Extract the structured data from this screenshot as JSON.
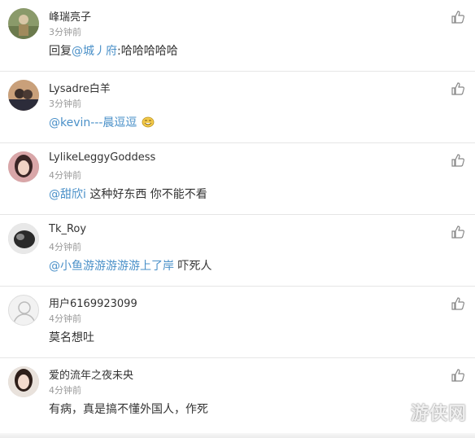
{
  "comments": [
    {
      "username": "峰瑞亮子",
      "time": "3分钟前",
      "prefix": "回复",
      "mention": "@城丿府",
      "text": ":哈哈哈哈哈",
      "avatar": "avatar-photo-outdoor"
    },
    {
      "username": "Lysadre白羊",
      "time": "3分钟前",
      "prefix": "",
      "mention": "@kevin---晨逗逗",
      "text": "",
      "emoji": "grin-emoji",
      "avatar": "avatar-photo-couple"
    },
    {
      "username": "LylikeLeggyGoddess",
      "time": "4分钟前",
      "prefix": "",
      "mention": "@甜欣i",
      "text": " 这种好东西 你不能不看",
      "avatar": "avatar-photo-girl"
    },
    {
      "username": "Tk_Roy",
      "time": "4分钟前",
      "prefix": "",
      "mention": "@小鱼游游游游游上了岸",
      "text": " 吓死人",
      "avatar": "avatar-photo-bw"
    },
    {
      "username": "用户6169923099",
      "time": "4分钟前",
      "prefix": "",
      "mention": "",
      "text": "莫名想吐",
      "avatar": "avatar-default"
    },
    {
      "username": "爱的流年之夜未央",
      "time": "4分钟前",
      "prefix": "",
      "mention": "",
      "text": "有病，真是搞不懂外国人，作死",
      "avatar": "avatar-photo-woman"
    }
  ],
  "watermark": "游侠网",
  "colors": {
    "mention": "#4a90c8",
    "time": "#999999",
    "divider": "#e6e6e6"
  },
  "icons": {
    "like": "thumbs-up-icon"
  }
}
